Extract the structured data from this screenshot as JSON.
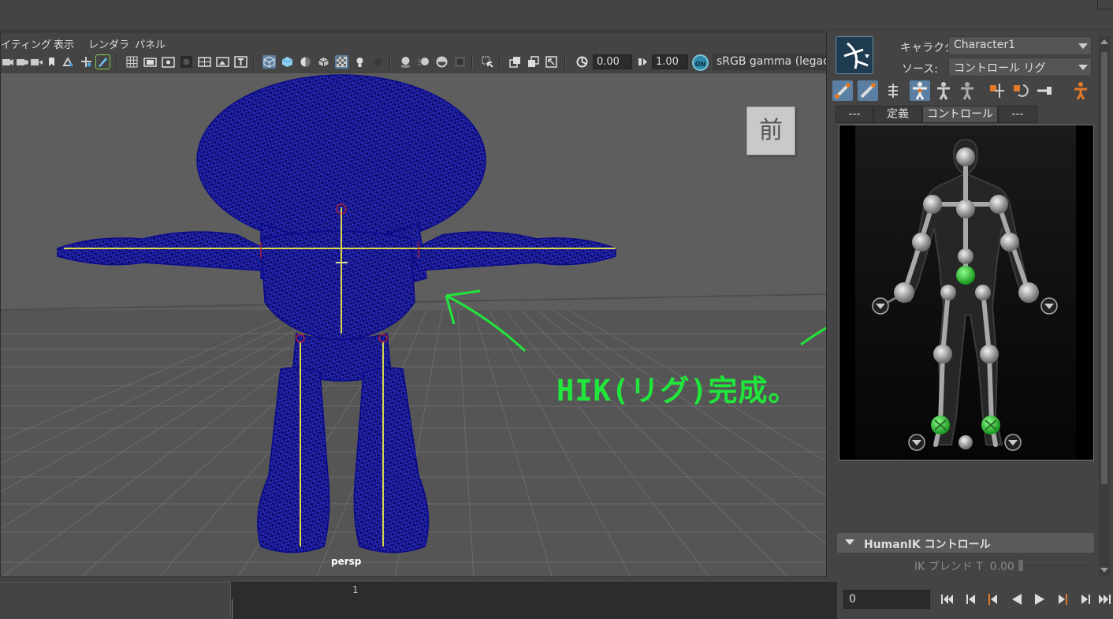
{
  "menubar": {
    "items": [
      "イティング",
      "表示",
      "レンダラ",
      "パネル"
    ]
  },
  "toolbar": {
    "exposure_value": "0.00",
    "gamma_value": "1.00",
    "color_management_toggle": "ON",
    "colorspace": "sRGB gamma (legacy)",
    "icons": [
      "camera-select-icon",
      "camera-attributes-icon",
      "bookmark-icon",
      "image-plane-icon",
      "2d-pan-zoom-icon",
      "grease-pencil-icon",
      "grid-icon",
      "film-gate-icon",
      "resolution-gate-icon",
      "gate-mask-icon",
      "field-chart-icon",
      "safe-action-icon",
      "safe-title-icon",
      "wireframe-icon",
      "smooth-shade-icon",
      "use-default-material-icon",
      "wireframe-on-shaded-icon",
      "xray-icon",
      "use-all-lights-icon",
      "shadows-icon",
      "screen-space-ao-icon",
      "motion-blur-icon",
      "anti-aliasing-icon",
      "depth-of-field-icon",
      "isolate-select-icon",
      "xray-joints-icon",
      "xray-active-icon",
      "camera-position-icon",
      "exposure-icon",
      "gamma-icon"
    ]
  },
  "viewport": {
    "view_cube_face": "前",
    "camera_name": "persp",
    "annotation_text": "HIK(リグ)完成。",
    "wire_color": "#0a0a8c",
    "joint_color": "#d8d84a",
    "annotation_color": "#21e63b"
  },
  "hik_panel": {
    "character_label": "キャラクタ:",
    "character_value": "Character1",
    "source_label": "ソース:",
    "source_value": "コントロール リグ",
    "tools": [
      "select-fk-icon",
      "select-ik-icon",
      "show-skeleton-icon",
      "full-body-icon",
      "body-part-icon",
      "selection-icon",
      "pin-translate-icon",
      "pin-rotate-icon",
      "release-pin-icon",
      "stance-pose-icon"
    ],
    "tabs": [
      "---",
      "定義",
      "コントロール",
      "---"
    ],
    "active_tab": 2,
    "effector_active_color": "#2ecc40",
    "section_title": "HumanIK コントロール",
    "ik_blend_label": "IK ブレンド T",
    "ik_blend_value": "0.00"
  },
  "timeline": {
    "frame_tick": "1",
    "current_frame": "0",
    "playback_buttons": [
      "go-to-start-icon",
      "step-back-frame-icon",
      "step-back-key-icon",
      "play-backwards-icon",
      "play-forwards-icon",
      "step-forward-key-icon",
      "step-forward-frame-icon",
      "go-to-end-icon"
    ]
  }
}
